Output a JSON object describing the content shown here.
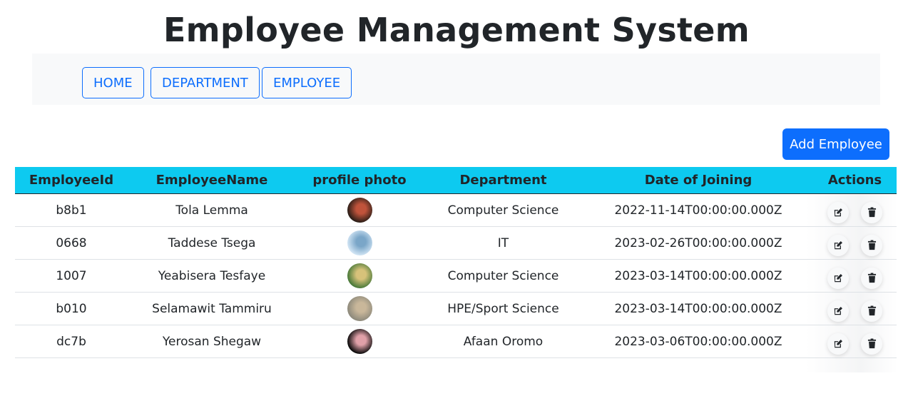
{
  "header": {
    "title": "Employee Management System"
  },
  "nav": {
    "items": [
      {
        "label": "HOME"
      },
      {
        "label": "DEPARTMENT"
      },
      {
        "label": "EMPLOYEE"
      }
    ]
  },
  "toolbar": {
    "add_label": "Add Employee"
  },
  "table": {
    "columns": [
      "EmployeeId",
      "EmployeeName",
      "profile photo",
      "Department",
      "Date of Joining",
      "Actions"
    ],
    "rows": [
      {
        "id": "b8b1",
        "name": "Tola Lemma",
        "department": "Computer Science",
        "date": "2022-11-14T00:00:00.000Z",
        "photo_colors": [
          "#2b1e17",
          "#c0533b"
        ]
      },
      {
        "id": "0668",
        "name": "Taddese Tsega",
        "department": "IT",
        "date": "2023-02-26T00:00:00.000Z",
        "photo_colors": [
          "#cfe3f3",
          "#7aa6c8"
        ]
      },
      {
        "id": "1007",
        "name": "Yeabisera Tesfaye",
        "department": "Computer Science",
        "date": "2023-03-14T00:00:00.000Z",
        "photo_colors": [
          "#4a7a3a",
          "#d7c27a"
        ]
      },
      {
        "id": "b010",
        "name": "Selamawit Tammiru",
        "department": "HPE/Sport Science",
        "date": "2023-03-14T00:00:00.000Z",
        "photo_colors": [
          "#8e8a7c",
          "#c9b79a"
        ]
      },
      {
        "id": "dc7b",
        "name": "Yerosan Shegaw",
        "department": "Afaan Oromo",
        "date": "2023-03-06T00:00:00.000Z",
        "photo_colors": [
          "#0b0b0b",
          "#e0a0a8"
        ]
      }
    ],
    "edit_icon": "edit-icon",
    "delete_icon": "trash-icon"
  },
  "colors": {
    "accent": "#0d6efd",
    "header_bg": "#0dcaf0",
    "nav_bg": "#f8f9fa"
  }
}
